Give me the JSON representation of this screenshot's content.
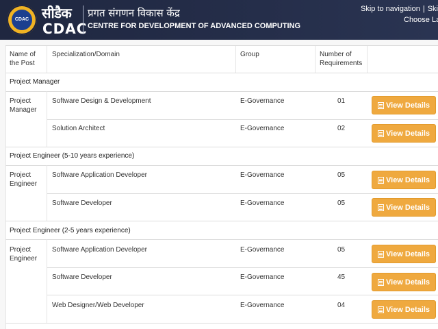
{
  "header": {
    "logo_hindi": "सीडैक",
    "logo_english": "CDAC",
    "emblem_text": "CDAC",
    "org_name_hindi": "प्रगत संगणन विकास केंद्र",
    "org_name_english": "CENTRE FOR DEVELOPMENT OF ADVANCED COMPUTING",
    "skip_navigation": "Skip to navigation",
    "skip_content": "Skip to",
    "separator": "|",
    "choose_language": "Choose Lan"
  },
  "table": {
    "columns": {
      "post": "Name of the Post",
      "specialization": "Specialization/Domain",
      "group": "Group",
      "requirements": "Number of Requirements"
    },
    "groups": [
      {
        "title": "Project Manager",
        "post": "Project Manager",
        "rows": [
          {
            "specialization": "Software Design & Development",
            "group": "E-Governance",
            "count": "01",
            "button": "View Details"
          },
          {
            "specialization": "Solution Architect",
            "group": "E-Governance",
            "count": "02",
            "button": "View Details"
          }
        ]
      },
      {
        "title": "Project Engineer (5-10 years experience)",
        "post": "Project Engineer",
        "rows": [
          {
            "specialization": "Software Application Developer",
            "group": "E-Governance",
            "count": "05",
            "button": "View Details"
          },
          {
            "specialization": "Software Developer",
            "group": "E-Governance",
            "count": "05",
            "button": "View Details"
          }
        ]
      },
      {
        "title": "Project Engineer (2-5 years experience)",
        "post": "Project Engineer",
        "rows": [
          {
            "specialization": "Software Application Developer",
            "group": "E-Governance",
            "count": "05",
            "button": "View Details"
          },
          {
            "specialization": "Software Developer",
            "group": "E-Governance",
            "count": "45",
            "button": "View Details"
          },
          {
            "specialization": "Web Designer/Web Developer",
            "group": "E-Governance",
            "count": "04",
            "button": "View Details"
          }
        ]
      }
    ]
  },
  "colors": {
    "header_bg": "#222a44",
    "button_bg": "#efa93f",
    "border": "#dcdcdc"
  }
}
